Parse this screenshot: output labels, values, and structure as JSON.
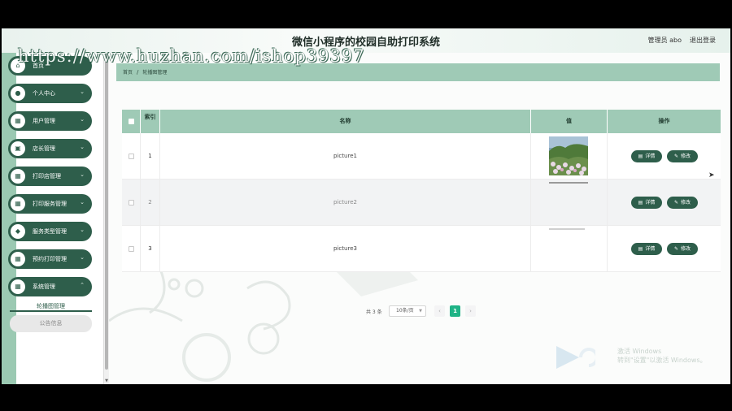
{
  "app": {
    "title": "微信小程序的校园自助打印系统",
    "admin_label": "管理员 abo",
    "logout": "退出登录",
    "watermark": "https://www.huzhan.com/ishop39397"
  },
  "sidebar": {
    "items": [
      {
        "label": "首页",
        "icon": "home-icon"
      },
      {
        "label": "个人中心",
        "icon": "user-icon"
      },
      {
        "label": "用户管理",
        "icon": "grid-icon"
      },
      {
        "label": "店长管理",
        "icon": "briefcase-icon"
      },
      {
        "label": "打印店管理",
        "icon": "grid-icon"
      },
      {
        "label": "打印服务管理",
        "icon": "grid-icon"
      },
      {
        "label": "服务类型管理",
        "icon": "tag-icon"
      },
      {
        "label": "预约打印管理",
        "icon": "grid-icon"
      },
      {
        "label": "系统管理",
        "icon": "grid-icon"
      }
    ],
    "submenu": {
      "active": "轮播图管理",
      "other": "公告信息"
    }
  },
  "breadcrumb": {
    "home": "首页",
    "separator": "/",
    "current": "轮播图管理"
  },
  "table": {
    "headers": {
      "index": "索引",
      "name": "名称",
      "value": "值",
      "actions": "操作"
    },
    "rows": [
      {
        "index": "1",
        "name": "picture1"
      },
      {
        "index": "2",
        "name": "picture2"
      },
      {
        "index": "3",
        "name": "picture3"
      }
    ],
    "detail_label": "详情",
    "edit_label": "修改"
  },
  "pagination": {
    "total": "共 3 条",
    "page_size": "10条/页",
    "prev": "‹",
    "current_page": "1",
    "next": "›"
  },
  "overlay": {
    "line1": "激活 Windows",
    "line2": "转到\"设置\"以激活 Windows。"
  },
  "colors": {
    "primary": "#2e5e4b",
    "header_bg": "#9fcab6",
    "pager_active": "#1fb386"
  }
}
